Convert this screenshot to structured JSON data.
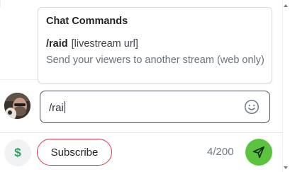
{
  "popup": {
    "title": "Chat Commands",
    "command": {
      "name": "/raid",
      "argument": "[livestream url]",
      "description": "Send your viewers to another stream (web only)"
    }
  },
  "composer": {
    "value": "/rai",
    "avatar_icon": "user-avatar",
    "emoji_icon": "smiley-face-icon"
  },
  "footer": {
    "tip_icon": "dollar-sign-icon",
    "subscribe_label": "Subscribe",
    "char_count": "4/200",
    "send_icon": "paper-plane-icon"
  },
  "colors": {
    "accent_green": "#5bc33e",
    "dollar_green": "#2f9e58",
    "subscribe_border": "#d9394c",
    "input_border": "#4a4f55"
  }
}
